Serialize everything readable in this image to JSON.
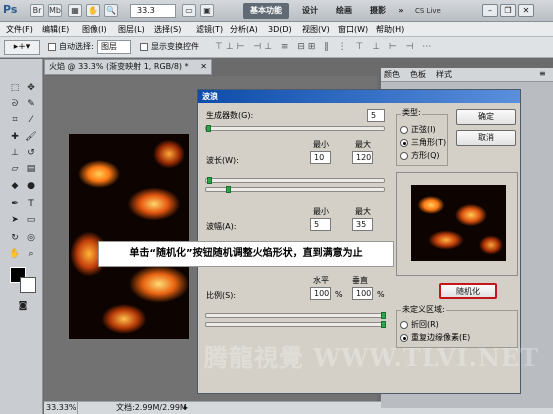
{
  "appbar": {
    "logo": "Ps",
    "zoom": "33.3",
    "workspaces": [
      "基本功能",
      "设计",
      "绘画",
      "摄影",
      "»"
    ],
    "cs_live": "CS Live"
  },
  "menubar": {
    "items": [
      "文件(F)",
      "编辑(E)",
      "图像(I)",
      "图层(L)",
      "选择(S)",
      "滤镜(T)",
      "分析(A)",
      "3D(D)",
      "视图(V)",
      "窗口(W)",
      "帮助(H)"
    ]
  },
  "options": {
    "auto_select_label": "自动选择:",
    "auto_select_value": "图层",
    "show_transform_label": "显示变换控件"
  },
  "document": {
    "tab_title": "火焰 @ 33.3% (渐变映射 1, RGB/8) *",
    "status_zoom": "33.33%",
    "status_doc": "文档:2.99M/2.99M"
  },
  "right_panel": {
    "tabs": [
      "颜色",
      "色板",
      "样式"
    ]
  },
  "dialog": {
    "title": "波浪",
    "generators_label": "生成器数(G):",
    "generators_value": "5",
    "wavelength_label": "波长(W):",
    "min_label": "最小",
    "max_label": "最大",
    "wavelength_min": "10",
    "wavelength_max": "120",
    "amplitude_label": "波幅(A):",
    "amplitude_min": "5",
    "amplitude_max": "35",
    "scale_label": "比例(S):",
    "horizontal_label": "水平",
    "vertical_label": "垂直",
    "scale_h": "100",
    "scale_v": "100",
    "percent": "%",
    "type_group": "类型:",
    "type_sine": "正弦(I)",
    "type_triangle": "三角形(T)",
    "type_square": "方形(Q)",
    "ok": "确定",
    "cancel": "取消",
    "randomize": "随机化",
    "undefined_group": "未定义区域:",
    "wrap_around": "折回(R)",
    "repeat_edge": "重复边缘像素(E)"
  },
  "tooltip": "单击“随机化”按钮随机调整火焰形状，直到满意为止",
  "watermark": "腾龍視覺 WWW.TLVI.NET"
}
